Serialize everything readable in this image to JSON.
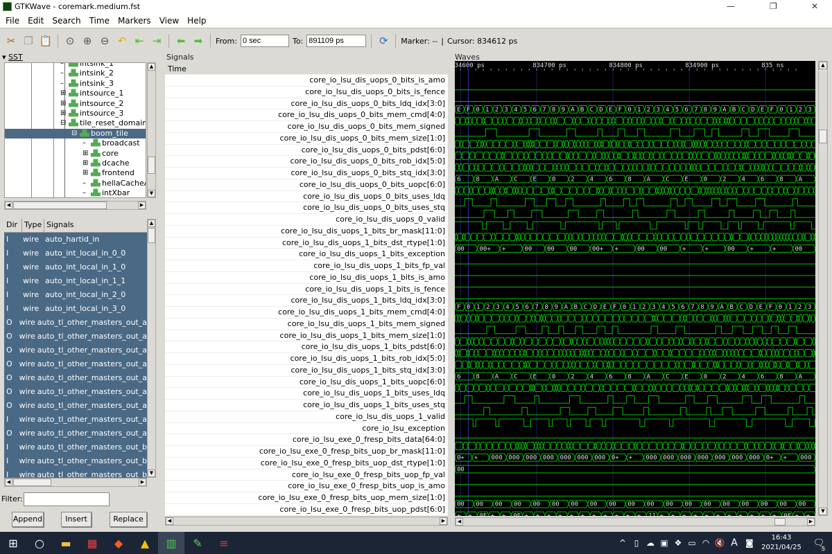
{
  "window": {
    "title": "GTKWave - coremark.medium.fst",
    "minimize": "—",
    "maximize": "❐",
    "close": "✕"
  },
  "menu": [
    "File",
    "Edit",
    "Search",
    "Time",
    "Markers",
    "View",
    "Help"
  ],
  "toolbar": {
    "from_label": "From:",
    "from_value": "0 sec",
    "to_label": "To:",
    "to_value": "891109 ps",
    "marker": "Marker: --",
    "separator": "|",
    "cursor": "Cursor: 834612 ps"
  },
  "sst": {
    "label": "SST",
    "tree": [
      {
        "name": "intsink_1",
        "indent": 0,
        "expander": "none",
        "partial": true
      },
      {
        "name": "intsink_2",
        "indent": 0,
        "expander": "none"
      },
      {
        "name": "intsink_3",
        "indent": 0,
        "expander": "none"
      },
      {
        "name": "intsource_1",
        "indent": 0,
        "expander": "plus"
      },
      {
        "name": "intsource_2",
        "indent": 0,
        "expander": "plus"
      },
      {
        "name": "intsource_3",
        "indent": 0,
        "expander": "plus"
      },
      {
        "name": "tile_reset_domain",
        "indent": 0,
        "expander": "minus"
      },
      {
        "name": "boom_tile",
        "indent": 1,
        "expander": "minus",
        "selected": true
      },
      {
        "name": "broadcast",
        "indent": 2,
        "expander": "none"
      },
      {
        "name": "core",
        "indent": 2,
        "expander": "plus"
      },
      {
        "name": "dcache",
        "indent": 2,
        "expander": "plus"
      },
      {
        "name": "frontend",
        "indent": 2,
        "expander": "plus"
      },
      {
        "name": "hellaCacheA",
        "indent": 2,
        "expander": "none"
      },
      {
        "name": "intXbar",
        "indent": 2,
        "expander": "none"
      }
    ]
  },
  "signal_list": {
    "headers": [
      "Dir",
      "Type",
      "Signals"
    ],
    "rows": [
      [
        "I",
        "wire",
        "auto_hartid_in"
      ],
      [
        "I",
        "wire",
        "auto_int_local_in_0_0"
      ],
      [
        "I",
        "wire",
        "auto_int_local_in_1_0"
      ],
      [
        "I",
        "wire",
        "auto_int_local_in_1_1"
      ],
      [
        "I",
        "wire",
        "auto_int_local_in_2_0"
      ],
      [
        "I",
        "wire",
        "auto_int_local_in_3_0"
      ],
      [
        "O",
        "wire",
        "auto_tl_other_masters_out_a"
      ],
      [
        "O",
        "wire",
        "auto_tl_other_masters_out_a"
      ],
      [
        "O",
        "wire",
        "auto_tl_other_masters_out_a"
      ],
      [
        "O",
        "wire",
        "auto_tl_other_masters_out_a"
      ],
      [
        "O",
        "wire",
        "auto_tl_other_masters_out_a"
      ],
      [
        "O",
        "wire",
        "auto_tl_other_masters_out_a"
      ],
      [
        "O",
        "wire",
        "auto_tl_other_masters_out_a"
      ],
      [
        "I",
        "wire",
        "auto_tl_other_masters_out_a"
      ],
      [
        "O",
        "wire",
        "auto_tl_other_masters_out_a"
      ],
      [
        "I",
        "wire",
        "auto_tl_other_masters_out_b"
      ],
      [
        "I",
        "wire",
        "auto_tl_other_masters_out_b"
      ],
      [
        "I",
        "wire",
        "auto_tl_other_masters_out_b"
      ]
    ]
  },
  "filter": {
    "label": "Filter:",
    "value": ""
  },
  "buttons": {
    "append": "Append",
    "insert": "Insert",
    "replace": "Replace"
  },
  "signals_pane": {
    "label": "Signals",
    "time_label": "Time",
    "signals": [
      {
        "name": "core_io_lsu_dis_uops_0_bits_is_amo",
        "kind": "low"
      },
      {
        "name": "core_io_lsu_dis_uops_0_bits_is_fence",
        "kind": "low"
      },
      {
        "name": "core_io_lsu_dis_uops_0_bits_ldq_idx[3:0]",
        "kind": "bus",
        "values": [
          "E",
          "F",
          "0",
          "1",
          "2",
          "3",
          "4",
          "5",
          "6",
          "7",
          "8",
          "9",
          "A",
          "B",
          "C",
          "D",
          "E",
          "F",
          "0",
          "1",
          "2",
          "3",
          "4",
          "5",
          "6",
          "7",
          "8",
          "9",
          "A",
          "B",
          "C",
          "D",
          "E",
          "F",
          "0",
          "1",
          "2",
          "3"
        ]
      },
      {
        "name": "core_io_lsu_dis_uops_0_bits_mem_cmd[4:0]",
        "kind": "dense"
      },
      {
        "name": "core_io_lsu_dis_uops_0_bits_mem_signed",
        "kind": "pulse"
      },
      {
        "name": "core_io_lsu_dis_uops_0_bits_mem_size[1:0]",
        "kind": "dense"
      },
      {
        "name": "core_io_lsu_dis_uops_0_bits_pdst[6:0]",
        "kind": "dense"
      },
      {
        "name": "core_io_lsu_dis_uops_0_bits_rob_idx[5:0]",
        "kind": "dense"
      },
      {
        "name": "core_io_lsu_dis_uops_0_bits_stq_idx[3:0]",
        "kind": "bus",
        "values": [
          "6",
          "8",
          "A",
          "C",
          "E",
          "0",
          "2",
          "4",
          "6",
          "8",
          "A",
          "C",
          "E",
          "0",
          "2",
          "4",
          "6",
          "8",
          "A"
        ]
      },
      {
        "name": "core_io_lsu_dis_uops_0_bits_uopc[6:0]",
        "kind": "dense"
      },
      {
        "name": "core_io_lsu_dis_uops_0_bits_uses_ldq",
        "kind": "pulse"
      },
      {
        "name": "core_io_lsu_dis_uops_0_bits_uses_stq",
        "kind": "pulse"
      },
      {
        "name": "core_io_lsu_dis_uops_0_valid",
        "kind": "highpulse"
      },
      {
        "name": "core_io_lsu_dis_uops_1_bits_br_mask[11:0]",
        "kind": "dense"
      },
      {
        "name": "core_io_lsu_dis_uops_1_bits_dst_rtype[1:0]",
        "kind": "bus",
        "values": [
          "00",
          "00+",
          "+",
          "00",
          "00",
          "00",
          "00+",
          "+",
          "00",
          "00",
          "+",
          "+",
          "00",
          "+",
          "+",
          "00"
        ]
      },
      {
        "name": "core_io_lsu_dis_uops_1_bits_exception",
        "kind": "low"
      },
      {
        "name": "core_io_lsu_dis_uops_1_bits_fp_val",
        "kind": "low"
      },
      {
        "name": "core_io_lsu_dis_uops_1_bits_is_amo",
        "kind": "low"
      },
      {
        "name": "core_io_lsu_dis_uops_1_bits_is_fence",
        "kind": "low"
      },
      {
        "name": "core_io_lsu_dis_uops_1_bits_ldq_idx[3:0]",
        "kind": "bus",
        "values": [
          "F",
          "0",
          "1",
          "2",
          "3",
          "4",
          "5",
          "6",
          "7",
          "8",
          "9",
          "A",
          "B",
          "C",
          "D",
          "E",
          "F",
          "0",
          "1",
          "2",
          "3",
          "4",
          "5",
          "6",
          "7",
          "8",
          "9",
          "A",
          "B",
          "C",
          "D",
          "E",
          "F",
          "0",
          "1",
          "2",
          "3"
        ]
      },
      {
        "name": "core_io_lsu_dis_uops_1_bits_mem_cmd[4:0]",
        "kind": "dense"
      },
      {
        "name": "core_io_lsu_dis_uops_1_bits_mem_signed",
        "kind": "pulse"
      },
      {
        "name": "core_io_lsu_dis_uops_1_bits_mem_size[1:0]",
        "kind": "dense"
      },
      {
        "name": "core_io_lsu_dis_uops_1_bits_pdst[6:0]",
        "kind": "dense"
      },
      {
        "name": "core_io_lsu_dis_uops_1_bits_rob_idx[5:0]",
        "kind": "dense"
      },
      {
        "name": "core_io_lsu_dis_uops_1_bits_stq_idx[3:0]",
        "kind": "bus",
        "values": [
          "6",
          "8",
          "A",
          "C",
          "E",
          "0",
          "2",
          "4",
          "6",
          "8",
          "A",
          "C",
          "E",
          "0",
          "2",
          "4",
          "6",
          "8",
          "A"
        ]
      },
      {
        "name": "core_io_lsu_dis_uops_1_bits_uopc[6:0]",
        "kind": "dense"
      },
      {
        "name": "core_io_lsu_dis_uops_1_bits_uses_ldq",
        "kind": "pulse"
      },
      {
        "name": "core_io_lsu_dis_uops_1_bits_uses_stq",
        "kind": "pulse"
      },
      {
        "name": "core_io_lsu_dis_uops_1_valid",
        "kind": "highpulse"
      },
      {
        "name": "core_io_lsu_exception",
        "kind": "low"
      },
      {
        "name": "core_io_lsu_exe_0_fresp_bits_data[64:0]",
        "kind": "dense"
      },
      {
        "name": "core_io_lsu_exe_0_fresp_bits_uop_br_mask[11:0]",
        "kind": "bus",
        "values": [
          "0+",
          "+",
          "000",
          "000",
          "000",
          "000",
          "000",
          "000",
          "000",
          "0+",
          "+",
          "000",
          "000",
          "000",
          "000",
          "000",
          "000",
          "000",
          "0+",
          "+",
          "000"
        ]
      },
      {
        "name": "core_io_lsu_exe_0_fresp_bits_uop_dst_rtype[1:0]",
        "kind": "bus",
        "values": [
          "00"
        ]
      },
      {
        "name": "core_io_lsu_exe_0_fresp_bits_uop_fp_val",
        "kind": "low"
      },
      {
        "name": "core_io_lsu_exe_0_fresp_bits_uop_is_amo",
        "kind": "low"
      },
      {
        "name": "core_io_lsu_exe_0_fresp_bits_uop_mem_size[1:0]",
        "kind": "bus",
        "values": [
          "00",
          "00",
          "00",
          "00",
          "00",
          "00",
          "00",
          "00",
          "00",
          "00",
          "00",
          "00",
          "00",
          "00",
          "00",
          "00",
          "00",
          "00",
          "00"
        ]
      },
      {
        "name": "core_io_lsu_exe_0_fresp_bits_uop_pdst[6:0]",
        "kind": "bus",
        "values": [
          "+",
          "+",
          "0E",
          "+",
          "+",
          "0E",
          "+",
          "+",
          "+",
          "+",
          "+",
          "+",
          "+",
          "+",
          "+",
          "+",
          "+",
          "11",
          "+",
          "+",
          "+",
          "+",
          "+",
          "+",
          "+",
          "+",
          "+",
          "+",
          "+",
          "0F",
          "+",
          "+"
        ]
      }
    ]
  },
  "waves_pane": {
    "label": "Waves",
    "time_ticks": [
      "834600 ps",
      "834700 ps",
      "834800 ps",
      "834900 ps",
      "835 ns"
    ],
    "cursor_ps": 834612,
    "colors": {
      "background": "#000000",
      "trace": "#00c000",
      "grid": "#1c1c60",
      "cursor": "#3030a0"
    }
  },
  "taskbar": {
    "time": "16:43",
    "date": "2021/04/25",
    "ime": "A",
    "notifications": "5"
  }
}
